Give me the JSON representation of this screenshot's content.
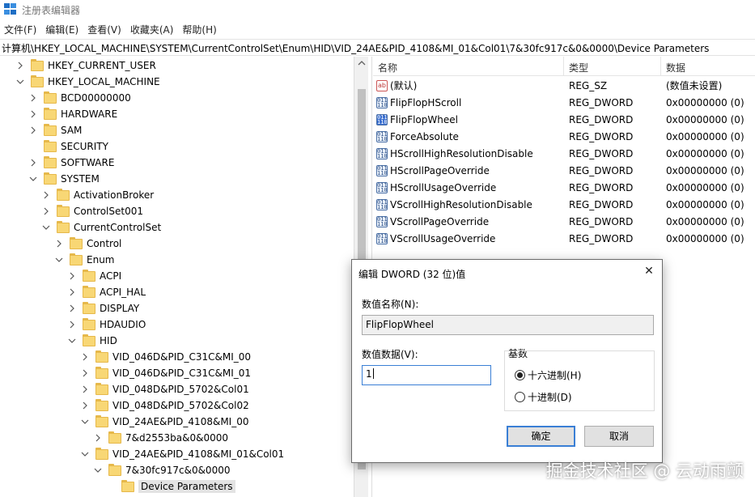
{
  "window": {
    "title": "注册表编辑器"
  },
  "menu": [
    "文件(F)",
    "编辑(E)",
    "查看(V)",
    "收藏夹(A)",
    "帮助(H)"
  ],
  "address": "计算机\\HKEY_LOCAL_MACHINE\\SYSTEM\\CurrentControlSet\\Enum\\HID\\VID_24AE&PID_4108&MI_01&Col01\\7&30fc917c&0&0000\\Device Parameters",
  "tree": [
    {
      "label": "HKEY_CURRENT_USER",
      "state": "collapsed"
    },
    {
      "label": "HKEY_LOCAL_MACHINE",
      "state": "expanded"
    },
    {
      "label": "BCD00000000",
      "state": "collapsed"
    },
    {
      "label": "HARDWARE",
      "state": "collapsed"
    },
    {
      "label": "SAM",
      "state": "collapsed"
    },
    {
      "label": "SECURITY",
      "state": "none"
    },
    {
      "label": "SOFTWARE",
      "state": "collapsed"
    },
    {
      "label": "SYSTEM",
      "state": "expanded"
    },
    {
      "label": "ActivationBroker",
      "state": "collapsed"
    },
    {
      "label": "ControlSet001",
      "state": "collapsed"
    },
    {
      "label": "CurrentControlSet",
      "state": "expanded"
    },
    {
      "label": "Control",
      "state": "collapsed"
    },
    {
      "label": "Enum",
      "state": "expanded"
    },
    {
      "label": "ACPI",
      "state": "collapsed"
    },
    {
      "label": "ACPI_HAL",
      "state": "collapsed"
    },
    {
      "label": "DISPLAY",
      "state": "collapsed"
    },
    {
      "label": "HDAUDIO",
      "state": "collapsed"
    },
    {
      "label": "HID",
      "state": "expanded"
    },
    {
      "label": "VID_046D&PID_C31C&MI_00",
      "state": "collapsed"
    },
    {
      "label": "VID_046D&PID_C31C&MI_01",
      "state": "collapsed"
    },
    {
      "label": "VID_048D&PID_5702&Col01",
      "state": "collapsed"
    },
    {
      "label": "VID_048D&PID_5702&Col02",
      "state": "collapsed"
    },
    {
      "label": "VID_24AE&PID_4108&MI_00",
      "state": "expanded"
    },
    {
      "label": "7&d2553ba&0&0000",
      "state": "collapsed"
    },
    {
      "label": "VID_24AE&PID_4108&MI_01&Col01",
      "state": "expanded"
    },
    {
      "label": "7&30fc917c&0&0000",
      "state": "expanded"
    },
    {
      "label": "Device Parameters",
      "state": "none",
      "selected": true
    }
  ],
  "list": {
    "headers": [
      "名称",
      "类型",
      "数据"
    ],
    "rows": [
      {
        "icon": "string-value-icon",
        "name": "(默认)",
        "type": "REG_SZ",
        "data": "(数值未设置)"
      },
      {
        "icon": "binary-value-icon",
        "name": "FlipFlopHScroll",
        "type": "REG_DWORD",
        "data": "0x00000000 (0)"
      },
      {
        "icon": "binary-value-icon",
        "name": "FlipFlopWheel",
        "type": "REG_DWORD",
        "data": "0x00000000 (0)",
        "selected": true
      },
      {
        "icon": "binary-value-icon",
        "name": "ForceAbsolute",
        "type": "REG_DWORD",
        "data": "0x00000000 (0)"
      },
      {
        "icon": "binary-value-icon",
        "name": "HScrollHighResolutionDisable",
        "type": "REG_DWORD",
        "data": "0x00000000 (0)"
      },
      {
        "icon": "binary-value-icon",
        "name": "HScrollPageOverride",
        "type": "REG_DWORD",
        "data": "0x00000000 (0)"
      },
      {
        "icon": "binary-value-icon",
        "name": "HScrollUsageOverride",
        "type": "REG_DWORD",
        "data": "0x00000000 (0)"
      },
      {
        "icon": "binary-value-icon",
        "name": "VScrollHighResolutionDisable",
        "type": "REG_DWORD",
        "data": "0x00000000 (0)"
      },
      {
        "icon": "binary-value-icon",
        "name": "VScrollPageOverride",
        "type": "REG_DWORD",
        "data": "0x00000000 (0)"
      },
      {
        "icon": "binary-value-icon",
        "name": "VScrollUsageOverride",
        "type": "REG_DWORD",
        "data": "0x00000000 (0)"
      }
    ]
  },
  "dialog": {
    "title": "编辑 DWORD (32 位)值",
    "close_glyph": "✕",
    "name_label": "数值名称(N):",
    "name_value": "FlipFlopWheel",
    "data_label": "数值数据(V):",
    "data_value": "1",
    "base_label": "基数",
    "radio_hex": "十六进制(H)",
    "radio_dec": "十进制(D)",
    "base_selected": "hex",
    "ok": "确定",
    "cancel": "取消"
  },
  "watermark": "掘金技术社区 @ 云动雨颤",
  "colors": {
    "accent": "#3a7fd5",
    "folder": "#f8d775",
    "selection": "#e3e3e3"
  }
}
